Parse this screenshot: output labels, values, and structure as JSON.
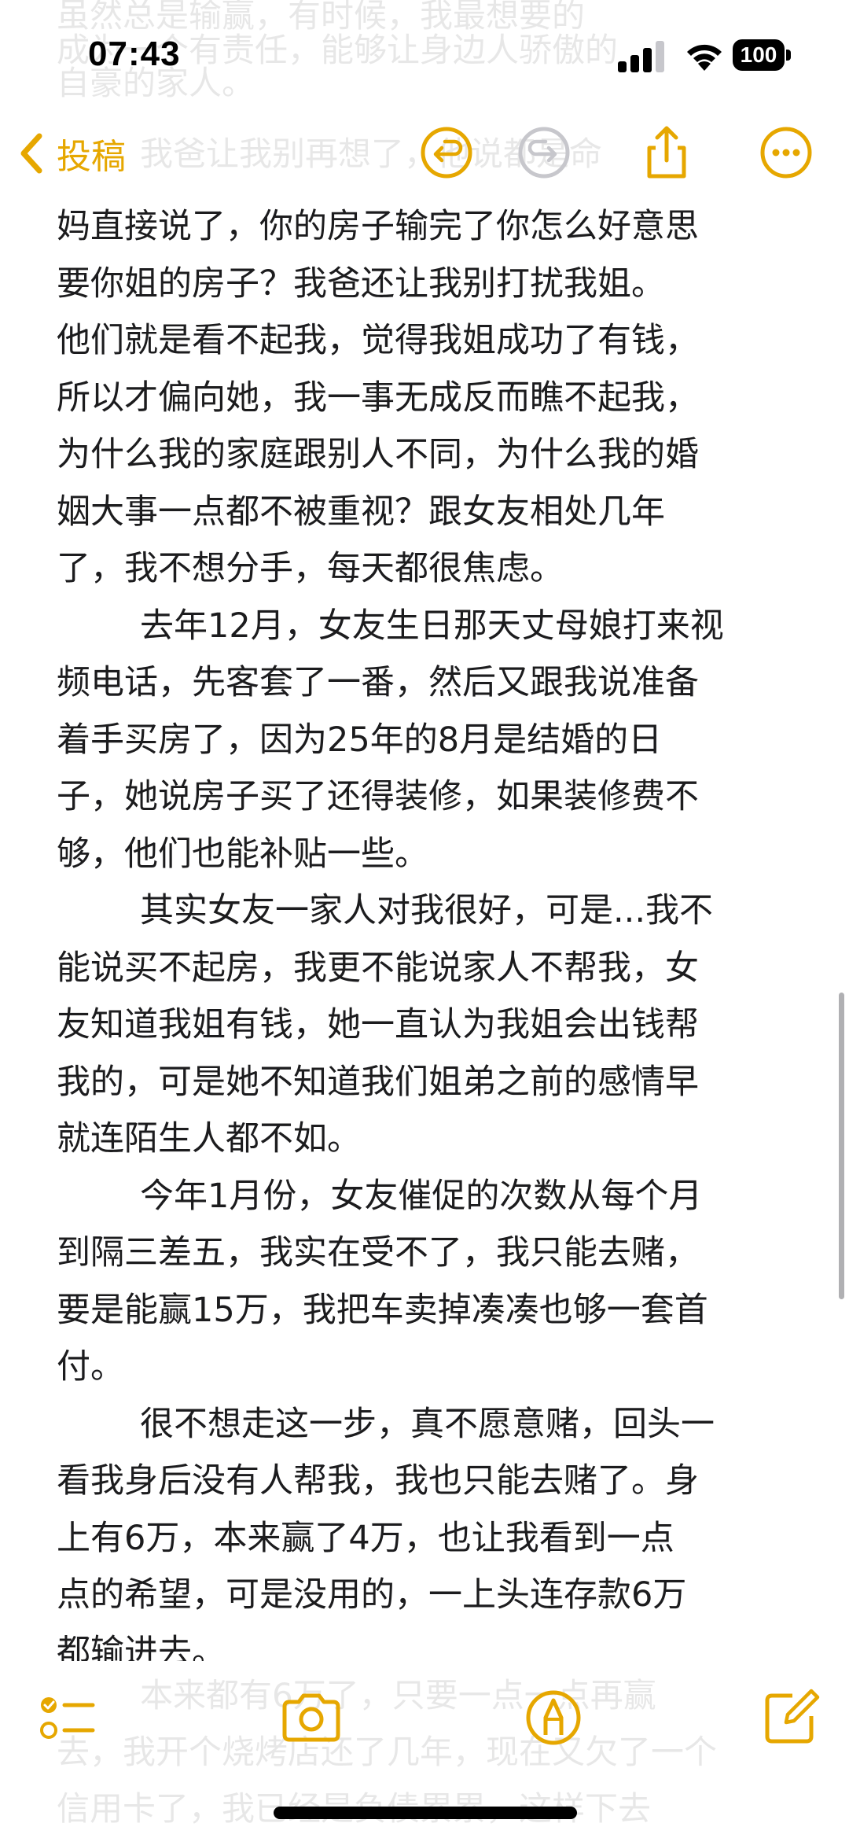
{
  "status_bar": {
    "time": "07:43",
    "battery": "100"
  },
  "nav": {
    "back_label": "投稿",
    "icons": [
      "chevron-left-icon",
      "undo-icon",
      "redo-icon",
      "share-icon",
      "more-icon"
    ]
  },
  "colors": {
    "accent": "#e6a700",
    "disabled": "#c7c7cc",
    "text": "#1c1c1e"
  },
  "ghost_top": [
    "虽然总是输赢，有时候，我最想要的",
    "成为一个有责任，能够让身边人骄傲的",
    "自豪的家人。",
    "我爸让我别再想了，他说都是命"
  ],
  "ghost_bottom": [
    "本来都有6万了，只要一点一点再赢",
    "去，我开个烧烤店还了几年，现在又欠了一个",
    "信用卡了，我已经是负债累累，这样下去"
  ],
  "note": {
    "lines": [
      "妈直接说了，你的房子输完了你怎么好意思",
      "要你姐的房子？我爸还让我别打扰我姐。",
      "他们就是看不起我，觉得我姐成功了有钱，",
      "所以才偏向她，我一事无成反而瞧不起我，",
      "为什么我的家庭跟别人不同，为什么我的婚",
      "姻大事一点都不被重视？跟女友相处几年",
      "了，我不想分手，每天都很焦虑。",
      "去年12月，女友生日那天丈母娘打来视",
      "频电话，先客套了一番，然后又跟我说准备",
      "着手买房了，因为25年的8月是结婚的日",
      "子，她说房子买了还得装修，如果装修费不",
      "够，他们也能补贴一些。",
      "其实女友一家人对我很好，可是...我不",
      "能说买不起房，我更不能说家人不帮我，女",
      "友知道我姐有钱，她一直认为我姐会出钱帮",
      "我的，可是她不知道我们姐弟之前的感情早",
      "就连陌生人都不如。",
      "今年1月份，女友催促的次数从每个月",
      "到隔三差五，我实在受不了，我只能去赌，",
      "要是能赢15万，我把车卖掉凑凑也够一套首",
      "付。",
      "很不想走这一步，真不愿意赌，回头一",
      "看我身后没有人帮我，我也只能去赌了。身",
      "上有6万，本来赢了4万，也让我看到一点",
      "点的希望，可是没用的，一上头连存款6万",
      "都输进去。"
    ],
    "indent_lines": [
      7,
      12,
      17,
      21
    ]
  },
  "toolbar": {
    "icons": [
      "checklist-icon",
      "camera-icon",
      "markup-pen-icon",
      "compose-icon"
    ]
  }
}
